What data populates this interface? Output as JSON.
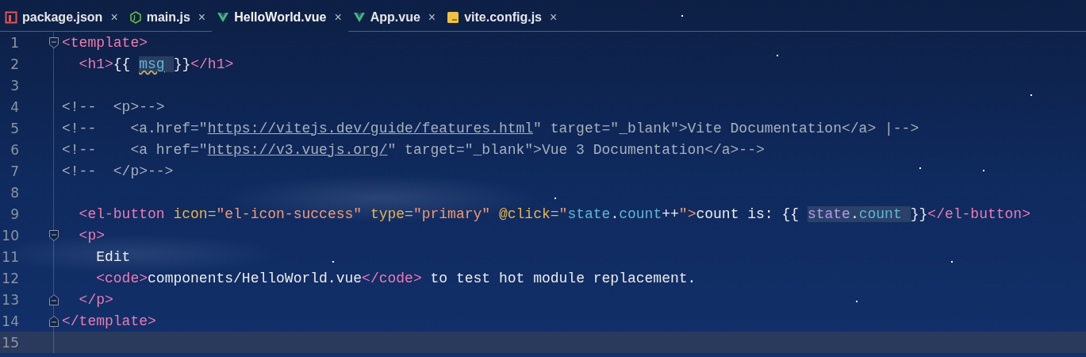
{
  "tabs": [
    {
      "label": "package.json",
      "kind": "json",
      "close": "×",
      "selected": false
    },
    {
      "label": "main.js",
      "kind": "node",
      "close": "×",
      "selected": false
    },
    {
      "label": "HelloWorld.vue",
      "kind": "vue",
      "close": "×",
      "selected": true
    },
    {
      "label": "App.vue",
      "kind": "vue",
      "close": "×",
      "selected": false
    },
    {
      "label": "vite.config.js",
      "kind": "js",
      "close": "×",
      "selected": false
    }
  ],
  "lines": [
    {
      "number": "1",
      "kind": "fold-start",
      "current": false,
      "tokens": [
        {
          "t": "<template>",
          "kind": "tag"
        }
      ]
    },
    {
      "number": "2",
      "current": false,
      "tokens": [
        {
          "t": "  <h1>",
          "kind": "tag"
        },
        {
          "t": "{{ ",
          "kind": "text"
        },
        {
          "t": "msg",
          "kind": "var",
          "hl": true,
          "warning": true
        },
        {
          "t": "}}",
          "kind": "text"
        },
        {
          "t": "</h1>",
          "kind": "tag"
        }
      ]
    },
    {
      "number": "3",
      "current": false
    },
    {
      "number": "4",
      "current": false,
      "tokens": [
        {
          "t": "<!--  <p>-->",
          "kind": "comment"
        }
      ]
    },
    {
      "number": "5",
      "current": false,
      "tokens": [
        {
          "t": "<!--    <a.href=\"",
          "kind": "comment"
        },
        {
          "t": "https://vitejs.dev/guide/features.html",
          "kind": "link"
        },
        {
          "t": "\" target=\"_blank\">Vite Documentation</a> |-->",
          "kind": "comment"
        }
      ]
    },
    {
      "number": "6",
      "current": false,
      "tokens": [
        {
          "t": "<!--    <a href=\"",
          "kind": "comment"
        },
        {
          "t": "https://v3.vuejs.org/",
          "kind": "link"
        },
        {
          "t": "\" target=\"_blank\">Vue 3 Documentation</a>-->",
          "kind": "comment"
        }
      ]
    },
    {
      "number": "7",
      "current": false,
      "tokens": [
        {
          "t": "<!--  </p>-->",
          "kind": "comment"
        }
      ]
    },
    {
      "number": "8",
      "current": false
    },
    {
      "number": "9",
      "current": false,
      "tokens": [
        {
          "t": "  <el-button ",
          "kind": "tag"
        },
        {
          "t": "icon=",
          "kind": "attr"
        },
        {
          "t": "\"el-icon-success\" ",
          "kind": "string"
        },
        {
          "t": "type=",
          "kind": "attr"
        },
        {
          "t": "\"primary\" ",
          "kind": "string"
        },
        {
          "t": "@click=",
          "kind": "attr"
        },
        {
          "t": "\"",
          "kind": "string"
        },
        {
          "t": "state",
          "kind": "var"
        },
        {
          "t": ".",
          "kind": "text"
        },
        {
          "t": "count",
          "kind": "var"
        },
        {
          "t": "++",
          "kind": "text"
        },
        {
          "t": "\">",
          "kind": "string"
        },
        {
          "t": "count is: {{ ",
          "kind": "text"
        },
        {
          "t": "state",
          "kind": "object",
          "hl": true
        },
        {
          "t": ".",
          "kind": "text",
          "hl": true
        },
        {
          "t": "count",
          "kind": "var",
          "hl": true
        },
        {
          "t": "}}",
          "kind": "text"
        },
        {
          "t": "</el-button>",
          "kind": "tag"
        }
      ]
    },
    {
      "number": "10",
      "kind": "fold-start",
      "current": false,
      "tokens": [
        {
          "t": "  <p>",
          "kind": "tag"
        }
      ]
    },
    {
      "number": "11",
      "current": false,
      "tokens": [
        {
          "t": "    Edit",
          "kind": "text"
        }
      ]
    },
    {
      "number": "12",
      "current": false,
      "tokens": [
        {
          "t": "    <code>",
          "kind": "tag"
        },
        {
          "t": "components/HelloWorld.vue",
          "kind": "text"
        },
        {
          "t": "</code>",
          "kind": "tag"
        },
        {
          "t": " to test hot module replacement.",
          "kind": "text"
        }
      ]
    },
    {
      "number": "13",
      "kind": "fold-end",
      "current": false,
      "tokens": [
        {
          "t": "  </p>",
          "kind": "tag"
        }
      ]
    },
    {
      "number": "14",
      "kind": "fold-end",
      "current": false,
      "tokens": [
        {
          "t": "</template>",
          "kind": "tag"
        }
      ]
    },
    {
      "number": "15",
      "current": true
    }
  ]
}
